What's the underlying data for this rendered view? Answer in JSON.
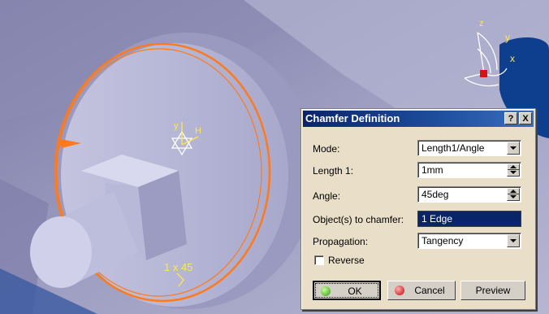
{
  "viewport": {
    "annotation": "1 x 45",
    "axis_labels": {
      "z": "z",
      "y": "y",
      "x": "x"
    },
    "compass_label_y": "y",
    "compass_label_h": "H"
  },
  "dialog": {
    "title": "Chamfer Definition",
    "help_label": "?",
    "close_label": "X",
    "mode": {
      "label": "Mode:",
      "value": "Length1/Angle"
    },
    "length1": {
      "label": "Length 1:",
      "value": "1mm"
    },
    "angle": {
      "label": "Angle:",
      "value": "45deg"
    },
    "objects": {
      "label": "Object(s) to chamfer:",
      "value": "1 Edge"
    },
    "propagation": {
      "label": "Propagation:",
      "value": "Tangency"
    },
    "reverse": {
      "label": "Reverse",
      "checked": false
    },
    "buttons": {
      "ok": "OK",
      "cancel": "Cancel",
      "preview": "Preview"
    }
  },
  "colors": {
    "background": "#a9a9c8",
    "part": "#c8c8e4",
    "highlight": "#ff7a1a",
    "title_bar": "#0a246a",
    "dialog_bg": "#e9dec7"
  }
}
